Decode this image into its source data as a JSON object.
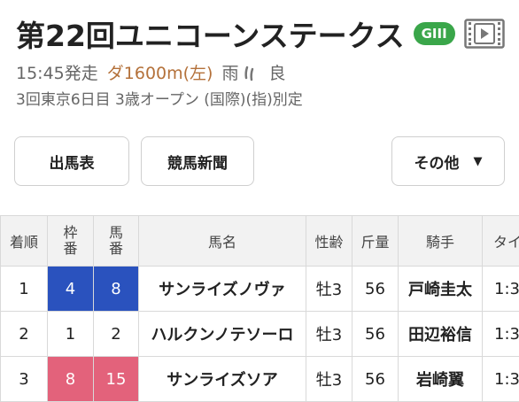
{
  "race": {
    "title": "第22回ユニコーンステークス",
    "grade": "GIII",
    "time_label": "15:45発走",
    "course": "ダ1600m(左)",
    "weather": "雨",
    "going": "良",
    "details": "3回東京6日目 3歳オープン (国際)(指)別定"
  },
  "buttons": {
    "shutuba": "出馬表",
    "shinbun": "競馬新聞",
    "sonota": "その他",
    "sonota_caret": "▼"
  },
  "table": {
    "headers": {
      "order": "着順",
      "waku_top": "枠",
      "waku_bottom": "番",
      "uma_top": "馬",
      "uma_bottom": "番",
      "name": "馬名",
      "sex_age": "性齢",
      "weight": "斤量",
      "jockey": "騎手",
      "time": "タイ"
    },
    "rows": [
      {
        "order": "1",
        "waku": "4",
        "umaban": "8",
        "name": "サンライズノヴァ",
        "sex_age": "牡3",
        "weight": "56",
        "jockey": "戸崎圭太",
        "time": "1:3"
      },
      {
        "order": "2",
        "waku": "1",
        "umaban": "2",
        "name": "ハルクンノテソーロ",
        "sex_age": "牡3",
        "weight": "56",
        "jockey": "田辺裕信",
        "time": "1:3"
      },
      {
        "order": "3",
        "waku": "8",
        "umaban": "15",
        "name": "サンライズソア",
        "sex_age": "牡3",
        "weight": "56",
        "jockey": "岩崎翼",
        "time": "1:3"
      }
    ]
  },
  "colors": {
    "waku4": "#2a52be",
    "waku8": "#e3627b",
    "grade_badge": "#3aa64a",
    "link": "#1e3aa0"
  },
  "icons": {
    "video": "video-play-icon",
    "rain": "rain-icon"
  }
}
